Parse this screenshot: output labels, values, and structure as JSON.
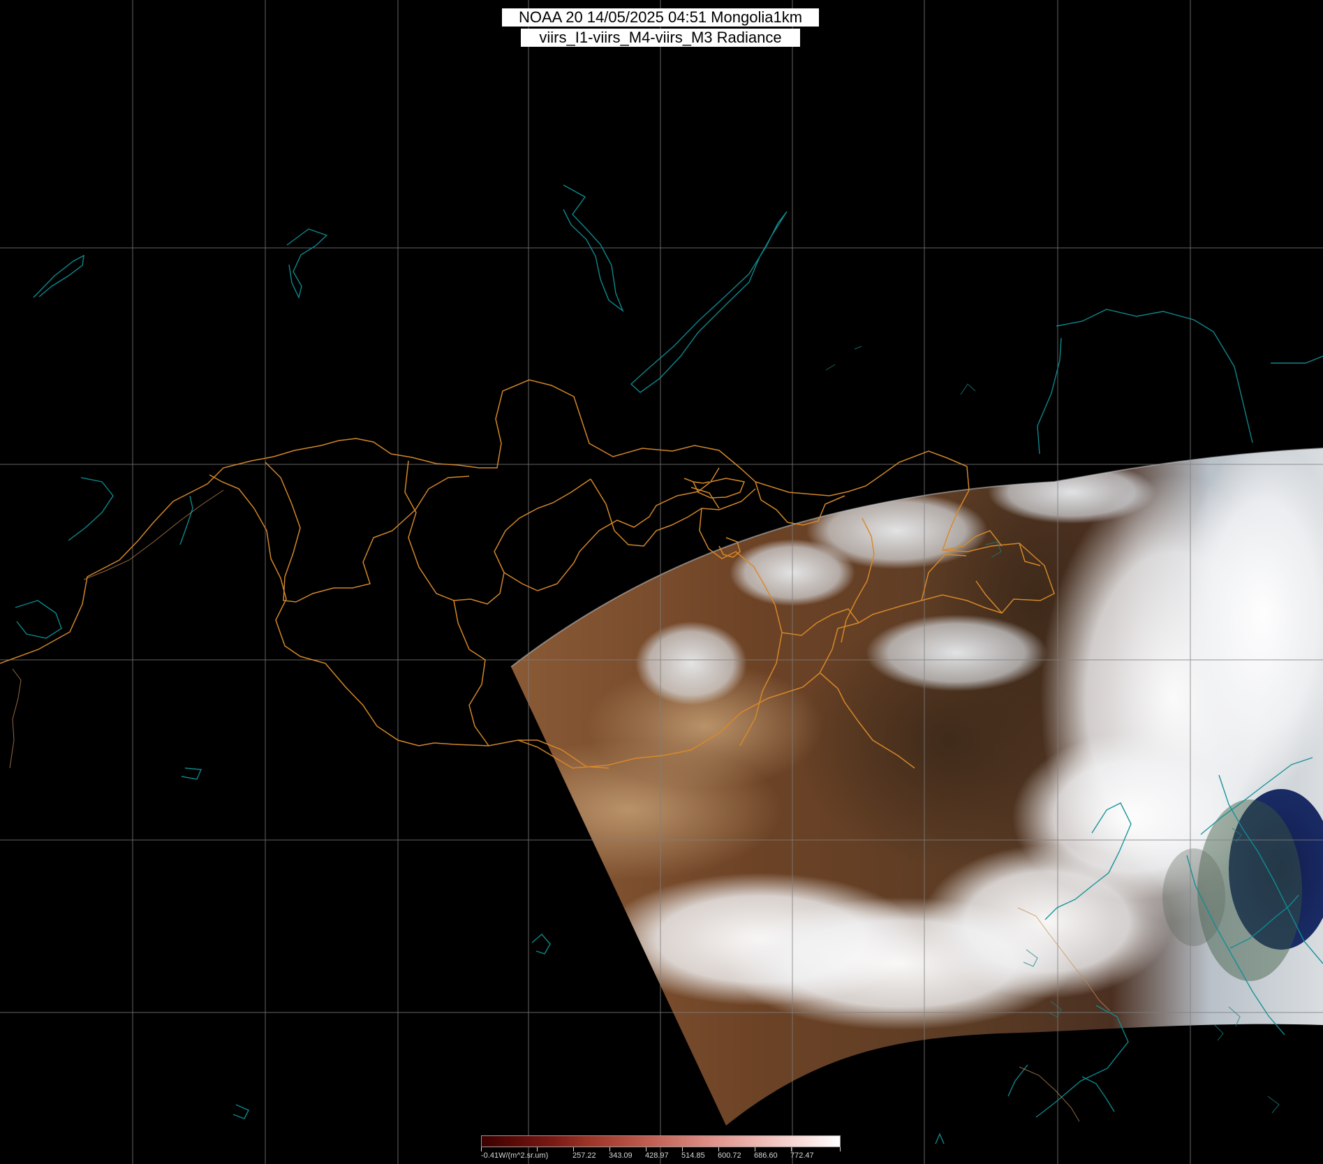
{
  "title": {
    "line1": "NOAA 20 14/05/2025 04:51 Mongolia1km",
    "line2": "viirs_I1-viirs_M4-viirs_M3 Radiance"
  },
  "colorbar": {
    "first_label": "-0.41W/(m^2.sr.um)",
    "labels": [
      "257.22",
      "343.09",
      "428.97",
      "514.85",
      "600.72",
      "686.60",
      "772.47"
    ]
  },
  "colors": {
    "background": "#000000",
    "grid": "#808080",
    "coastline": "#0f8f95",
    "border": "#d88a2a",
    "title_bg": "#ffffff",
    "title_text": "#000000"
  }
}
